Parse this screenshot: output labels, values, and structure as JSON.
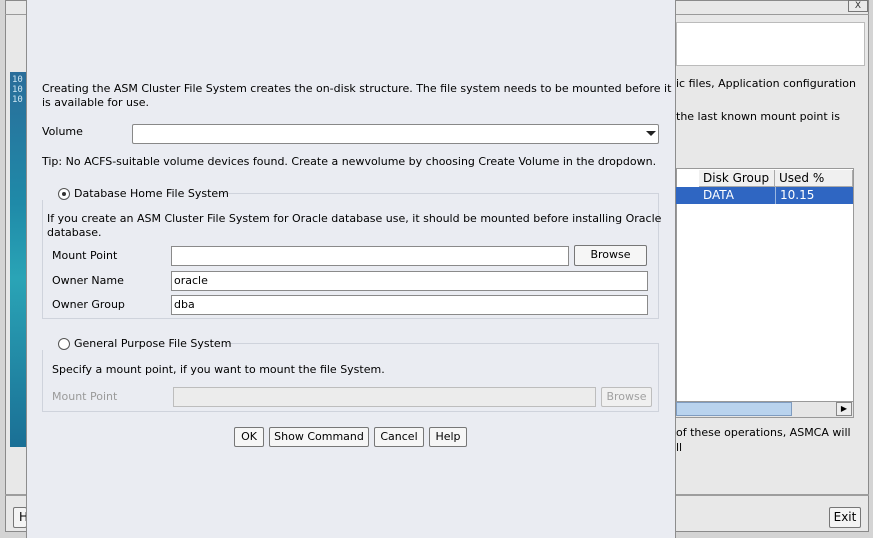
{
  "background_window": {
    "right_text_1": "ic files, Application configuration",
    "right_text_2": "the last known mount point is",
    "table": {
      "headers": [
        "Disk Group",
        "Used %"
      ],
      "row": [
        "DATA",
        "10.15"
      ]
    },
    "right_text_3": "of these operations, ASMCA will",
    "right_text_4": "ll",
    "exit_label": "Exit",
    "help_label_partial": "H",
    "close_glyph": "X",
    "left_bits": [
      "10",
      "10",
      "10"
    ]
  },
  "dialog": {
    "intro_line1": "Creating the ASM Cluster File System creates the on-disk structure. The file system needs to be mounted before it",
    "intro_line2": "is available for use.",
    "volume_label": "Volume",
    "volume_value": "",
    "tip": "Tip: No ACFS-suitable volume devices found. Create a newvolume by choosing Create Volume in the dropdown.",
    "db_home": {
      "radio_label": "Database Home File System",
      "selected": true,
      "desc_line1": "If you create an ASM Cluster File System for Oracle database use, it should be mounted before installing Oracle",
      "desc_line2": "database.",
      "mount_point_label": "Mount Point",
      "mount_point_value": "",
      "browse_label": "Browse",
      "owner_name_label": "Owner Name",
      "owner_name_value": "oracle",
      "owner_group_label": "Owner Group",
      "owner_group_value": "dba"
    },
    "general": {
      "radio_label": "General Purpose File System",
      "selected": false,
      "desc": "Specify a mount point, if you want to mount the file System.",
      "mount_point_label": "Mount Point",
      "mount_point_value": "",
      "browse_label": "Browse"
    },
    "buttons": {
      "ok": "OK",
      "show_command": "Show Command",
      "cancel": "Cancel",
      "help": "Help"
    }
  }
}
